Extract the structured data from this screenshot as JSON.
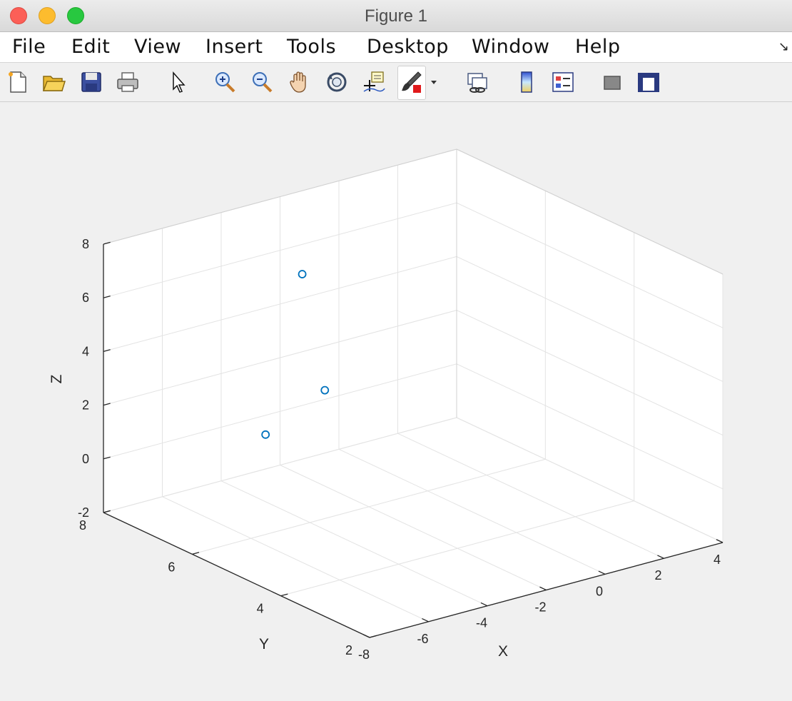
{
  "window": {
    "title": "Figure 1"
  },
  "menu": {
    "items": [
      "File",
      "Edit",
      "View",
      "Insert",
      "Tools",
      "Desktop",
      "Window",
      "Help"
    ],
    "overflow": "↘"
  },
  "toolbar": {
    "icons": [
      "new-figure-icon",
      "open-file-icon",
      "save-icon",
      "print-icon",
      "edit-plot-icon",
      "zoom-in-icon",
      "zoom-out-icon",
      "pan-icon",
      "rotate-3d-icon",
      "data-cursor-icon",
      "brush-icon",
      "brush-dropdown-icon",
      "link-plot-icon",
      "colorbar-icon",
      "legend-icon",
      "hide-plot-tools-icon",
      "show-plot-tools-icon"
    ]
  },
  "chart_data": {
    "type": "scatter",
    "projection": "3d",
    "xlabel": "X",
    "ylabel": "Y",
    "zlabel": "Z",
    "xlim": [
      -8,
      4
    ],
    "ylim": [
      2,
      8
    ],
    "zlim": [
      -2,
      8
    ],
    "xticks": [
      -8,
      -6,
      -4,
      -2,
      0,
      2,
      4
    ],
    "yticks": [
      2,
      4,
      6,
      8
    ],
    "zticks": [
      -2,
      0,
      2,
      4,
      6,
      8
    ],
    "grid": true,
    "marker": "circle",
    "marker_color": "#0072bd",
    "points": [
      {
        "x": -2,
        "y": 7.5,
        "z": 5.5
      },
      {
        "x": -5,
        "y": 5,
        "z": 4
      },
      {
        "x": -4,
        "y": 7,
        "z": 0.5
      }
    ]
  }
}
